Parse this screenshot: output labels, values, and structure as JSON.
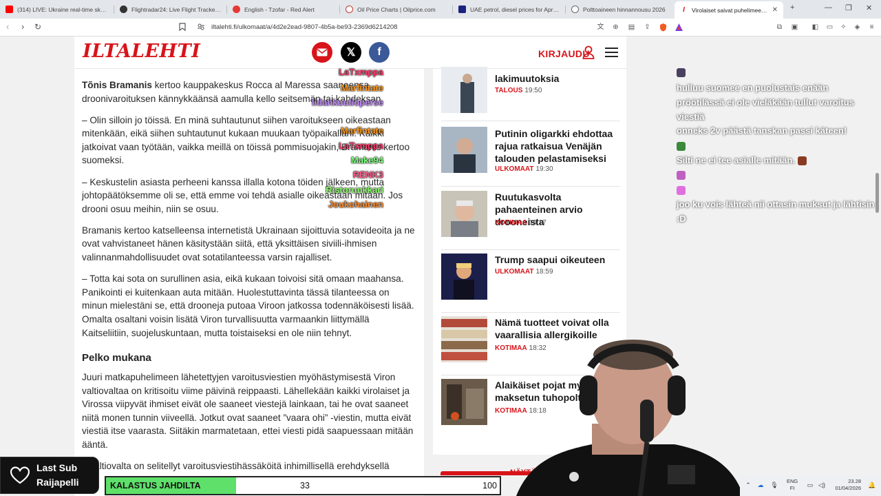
{
  "browser": {
    "tabs": [
      {
        "title": "(314) LIVE: Ukraine real-time skyline",
        "color": "#ff0000"
      },
      {
        "title": "Flightradar24: Live Flight Tracker - Re",
        "color": "#333333"
      },
      {
        "title": "English - Tzofar - Red Alert",
        "color": "#e53935"
      },
      {
        "title": "Oil Price Charts | Oilprice.com",
        "color": "#c0392b"
      },
      {
        "title": "UAE petrol, diesel prices for April 20",
        "color": "#1a237e"
      },
      {
        "title": "Polttoaineen hinnannousu 2026",
        "color": "#666666"
      },
      {
        "title": "Virolaiset saivat puhelimeensa k",
        "color": "#d7141a"
      }
    ],
    "url": "iltalehti.fi/ulkomaat/a/4d2e2ead-9807-4b5a-be93-2369d6214208"
  },
  "header": {
    "logo": "ILTALEHTI",
    "login": "KIRJAUDU"
  },
  "article": {
    "p1_name": "Tõnis Bramanis",
    "p1_rest": " kertoo kauppakeskus Rocca al Maressa saaneensa droonivaroituksen kännykkäänsä aamulla kello seitsemän tai kahdeksan.",
    "p2": "– Olin silloin jo töissä. En minä suhtautunut siihen varoitukseen oikeastaan mitenkään, eikä siihen suhtautunut kukaan muukaan työpaikallani. Kaikki jatkoivat vaan työtään, vaikka meillä on töissä pommisuojakin, Bramanis kertoo suomeksi.",
    "p3": "– Keskustelin asiasta perheeni kanssa illalla kotona töiden jälkeen, mutta johtopäätöksemme oli se, että emme voi tehdä asialle oikeastaan mitään. Jos drooni osuu meihin, niin se osuu.",
    "p4": "Bramanis kertoo katselleensa internetistä Ukrainaan sijoittuvia sotavideoita ja ne ovat vahvistaneet hänen käsitystään siitä, että yksittäisen siviili-ihmisen valinnanmahdollisuudet ovat sotatilanteessa varsin rajalliset.",
    "p5": "– Totta kai sota on surullinen asia, eikä kukaan toivoisi sitä omaan maahansa. Panikointi ei kuitenkaan auta mitään. Huolestuttavinta tässä tilanteessa on minun mielestäni se, että drooneja putoaa Viroon jatkossa todennäköisesti lisää. Omalta osaltani voisin lisätä Viron turvallisuutta varmaankin liittymällä Kaitseliitiin, suojeluskuntaan, mutta toistaiseksi en ole niin tehnyt.",
    "heading": "Pelko mukana",
    "p6": "Juuri matkapuhelimeen lähetettyjen varoitusviestien myöhästymisestä Viron valtiovaltaa on kritisoitu viime päivinä reippaasti. Lähellekään kaikki virolaiset ja Virossa viipyvät ihmiset eivät ole saaneet viestejä lainkaan, tai he ovat saaneet niitä monen tunnin viiveellä. Jotkut ovat saaneet ”vaara ohi” -viestin, mutta eivät viestiä itse vaarasta. Siitäkin marmatetaan, ettei viesti pidä saapuessaan mitään ääntä.",
    "p7": "n valtiovalta on selitellyt varoitusviestihässäköitä inhimillisellä erehdyksellä"
  },
  "sidebar": {
    "items": [
      {
        "title": "lakimuutoksia",
        "category": "TALOUS",
        "time": "19:50"
      },
      {
        "title": "Putinin oligarkki ehdottaa rajua ratkaisua Venäjän talouden pelastamiseksi",
        "category": "ULKOMAAT",
        "time": "19:30"
      },
      {
        "title": "Ruutukasvolta pahaenteinen arvio drooneista",
        "category": "KOTIMAA",
        "time": "19:17"
      },
      {
        "title": "Trump saapui oikeuteen",
        "category": "ULKOMAAT",
        "time": "18:59"
      },
      {
        "title": "Nämä tuotteet voivat olla vaarallisia allergikoille",
        "category": "KOTIMAA",
        "time": "18:32"
      },
      {
        "title": "Alaikäiset pojat myöntä maksetun tuhopolton",
        "category": "KOTIMAA",
        "time": "18:18"
      }
    ],
    "show_more": "NÄYTÄ LIS"
  },
  "chat": [
    {
      "user": "LaTxmppa",
      "color": "#ff3b6b",
      "message": ""
    },
    {
      "user": "Marfintate",
      "color": "#ff9a1f",
      "message": "hulluu suomee en puolustais enään"
    },
    {
      "user": "lidankuutioperse",
      "color": "#c58bff",
      "message": "pröötilässä ei ole vieläkään tullut varoitus viestiä"
    },
    {
      "user": "Marfintate",
      "color": "#ff9a1f",
      "message": "onneks 2v päästä tanskan passi käteen!"
    },
    {
      "user": "LaTxmppa",
      "color": "#ff3b6b",
      "message": ""
    },
    {
      "user": "Make94",
      "color": "#7dff7d",
      "message": "Silti ne ei tee asialle mitään."
    },
    {
      "user": "RENK3",
      "color": "#ff5a8a",
      "message": ""
    },
    {
      "user": "Ristorunkkari",
      "color": "#8cff6a",
      "message": ""
    },
    {
      "user": "Joukohainen",
      "color": "#ff8a2a",
      "message": "joo ku vois lähteä nii ottasin muksut ja lähtisin :D"
    }
  ],
  "overlay": {
    "last_sub_label": "Last Sub",
    "last_sub_name": "Raijapelli",
    "goal_label": "KALASTUS JAHDILTA",
    "goal_current": "33",
    "goal_target": "100",
    "goal_fraction": 0.33
  },
  "taskbar": {
    "lang_top": "ENG",
    "lang_bottom": "FI",
    "time": "23.28",
    "date": "01/04/2026"
  }
}
